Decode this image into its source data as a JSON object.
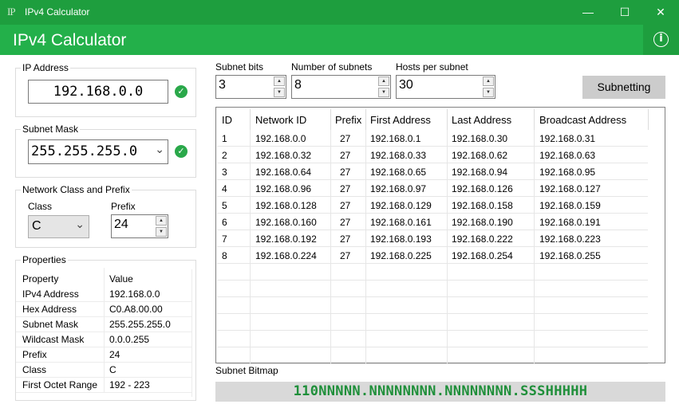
{
  "window": {
    "title": "IPv4 Calculator",
    "icon": "IP",
    "minimize": "—",
    "maximize": "☐",
    "close": "✕"
  },
  "header": {
    "title": "IPv4 Calculator",
    "info_icon": "i"
  },
  "ip_section": {
    "legend": "IP Address",
    "value": "192.168.0.0"
  },
  "mask_section": {
    "legend": "Subnet Mask",
    "value": "255.255.255.0",
    "chevron": "⌄"
  },
  "class_section": {
    "legend": "Network Class and Prefix",
    "class_label": "Class",
    "class_value": "C",
    "prefix_label": "Prefix",
    "prefix_value": "24"
  },
  "properties": {
    "legend": "Properties",
    "col_property": "Property",
    "col_value": "Value",
    "rows": [
      {
        "k": "IPv4 Address",
        "v": "192.168.0.0"
      },
      {
        "k": "Hex Address",
        "v": "C0.A8.00.00"
      },
      {
        "k": "Subnet Mask",
        "v": "255.255.255.0"
      },
      {
        "k": "Wildcast Mask",
        "v": "0.0.0.255"
      },
      {
        "k": "Prefix",
        "v": "24"
      },
      {
        "k": "Class",
        "v": "C"
      },
      {
        "k": "First Octet Range",
        "v": "192 - 223"
      }
    ]
  },
  "subnet_controls": {
    "bits_label": "Subnet bits",
    "bits_value": "3",
    "count_label": "Number of subnets",
    "count_value": "8",
    "hosts_label": "Hosts per subnet",
    "hosts_value": "30",
    "button": "Subnetting"
  },
  "grid": {
    "headers": [
      "ID",
      "Network ID",
      "Prefix",
      "First Address",
      "Last Address",
      "Broadcast Address"
    ],
    "rows": [
      [
        "1",
        "192.168.0.0",
        "27",
        "192.168.0.1",
        "192.168.0.30",
        "192.168.0.31"
      ],
      [
        "2",
        "192.168.0.32",
        "27",
        "192.168.0.33",
        "192.168.0.62",
        "192.168.0.63"
      ],
      [
        "3",
        "192.168.0.64",
        "27",
        "192.168.0.65",
        "192.168.0.94",
        "192.168.0.95"
      ],
      [
        "4",
        "192.168.0.96",
        "27",
        "192.168.0.97",
        "192.168.0.126",
        "192.168.0.127"
      ],
      [
        "5",
        "192.168.0.128",
        "27",
        "192.168.0.129",
        "192.168.0.158",
        "192.168.0.159"
      ],
      [
        "6",
        "192.168.0.160",
        "27",
        "192.168.0.161",
        "192.168.0.190",
        "192.168.0.191"
      ],
      [
        "7",
        "192.168.0.192",
        "27",
        "192.168.0.193",
        "192.168.0.222",
        "192.168.0.223"
      ],
      [
        "8",
        "192.168.0.224",
        "27",
        "192.168.0.225",
        "192.168.0.254",
        "192.168.0.255"
      ]
    ]
  },
  "bitmap": {
    "label": "Subnet Bitmap",
    "value": "110NNNNN.NNNNNNNN.NNNNNNNN.SSSHHHHH"
  },
  "colors": {
    "titlebar": "#1e9e3e",
    "header": "#23b04a",
    "check": "#2aa84a",
    "bitmap_text": "#1f8f3a"
  }
}
